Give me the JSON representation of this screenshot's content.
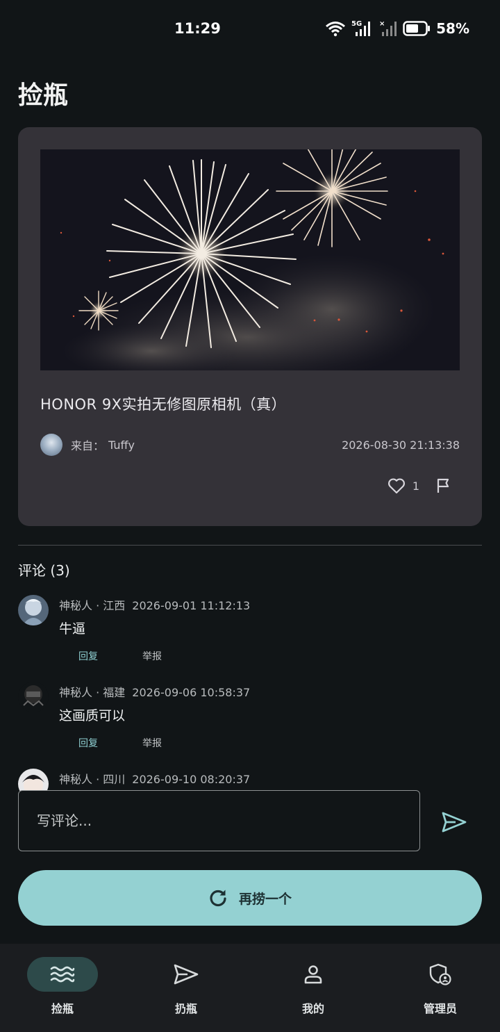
{
  "status_bar": {
    "time": "11:29",
    "network": "5G",
    "battery": "58%"
  },
  "page": {
    "title": "捡瓶"
  },
  "bottle": {
    "title": "HONOR 9X实拍无修图原相机（真）",
    "from_prefix": "来自：",
    "author": "Tuffy",
    "timestamp": "2026-08-30 21:13:38",
    "like_count": "1",
    "image_icon": "fireworks-photo",
    "like_icon": "heart-icon",
    "report_icon": "flag-icon"
  },
  "comments": {
    "heading": "评论 (3)",
    "reply_label": "回复",
    "report_label": "举报",
    "items": [
      {
        "author": "神秘人 · 江西",
        "time": "2026-09-01 11:12:13",
        "text": "牛逼"
      },
      {
        "author": "神秘人 · 福建",
        "time": "2026-09-06 10:58:37",
        "text": "这画质可以"
      },
      {
        "author": "神秘人 · 四川",
        "time": "2026-09-10 08:20:37",
        "text": ""
      }
    ]
  },
  "comment_input": {
    "placeholder": "写评论..."
  },
  "refresh": {
    "label": "再捞一个"
  },
  "nav": {
    "items": [
      {
        "label": "捡瓶",
        "icon": "waves-icon",
        "active": true
      },
      {
        "label": "扔瓶",
        "icon": "send-icon",
        "active": false
      },
      {
        "label": "我的",
        "icon": "person-icon",
        "active": false
      },
      {
        "label": "管理员",
        "icon": "shield-user-icon",
        "active": false
      }
    ]
  },
  "colors": {
    "background": "#111517",
    "card": "#343238",
    "accent": "#94d1d2",
    "nav_bg": "#1b1d20"
  }
}
